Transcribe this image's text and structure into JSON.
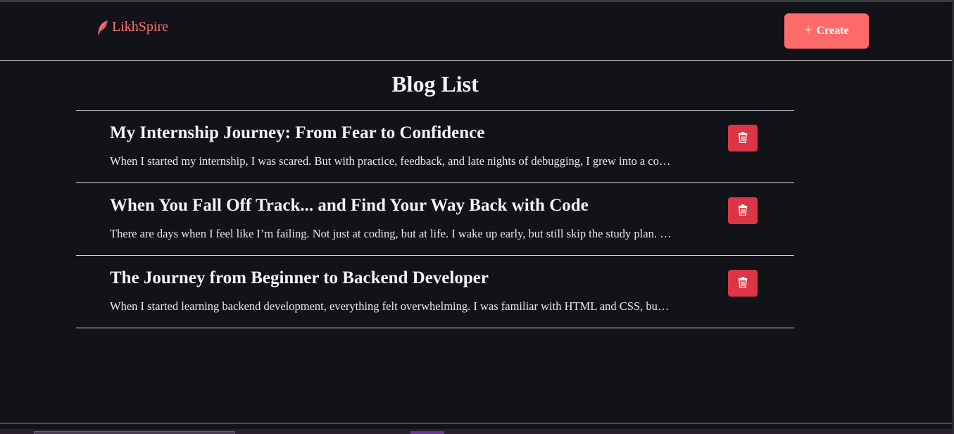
{
  "navbar": {
    "brand": "LikhSpire",
    "create_label": "Create"
  },
  "page_title": "Blog List",
  "posts": [
    {
      "title": "My Internship Journey: From Fear to Confidence",
      "excerpt": "When I started my internship, I was scared. But with practice, feedback, and late nights of debugging, I grew into a co…"
    },
    {
      "title": "When You Fall Off Track... and Find Your Way Back with Code",
      "excerpt": "There are days when I feel like I’m failing. Not just at coding, but at life. I wake up early, but still skip the study plan. …"
    },
    {
      "title": "The Journey from Beginner to Backend Developer",
      "excerpt": "When I started learning backend development, everything felt overwhelming. I was familiar with HTML and CSS, bu…"
    }
  ],
  "colors": {
    "background": "#111318",
    "accent": "#ff6b6b",
    "danger": "#dc3545",
    "text": "#f4f4f4"
  },
  "icons": {
    "brand": "feather-icon",
    "create": "plus-icon",
    "delete": "trash-icon"
  }
}
